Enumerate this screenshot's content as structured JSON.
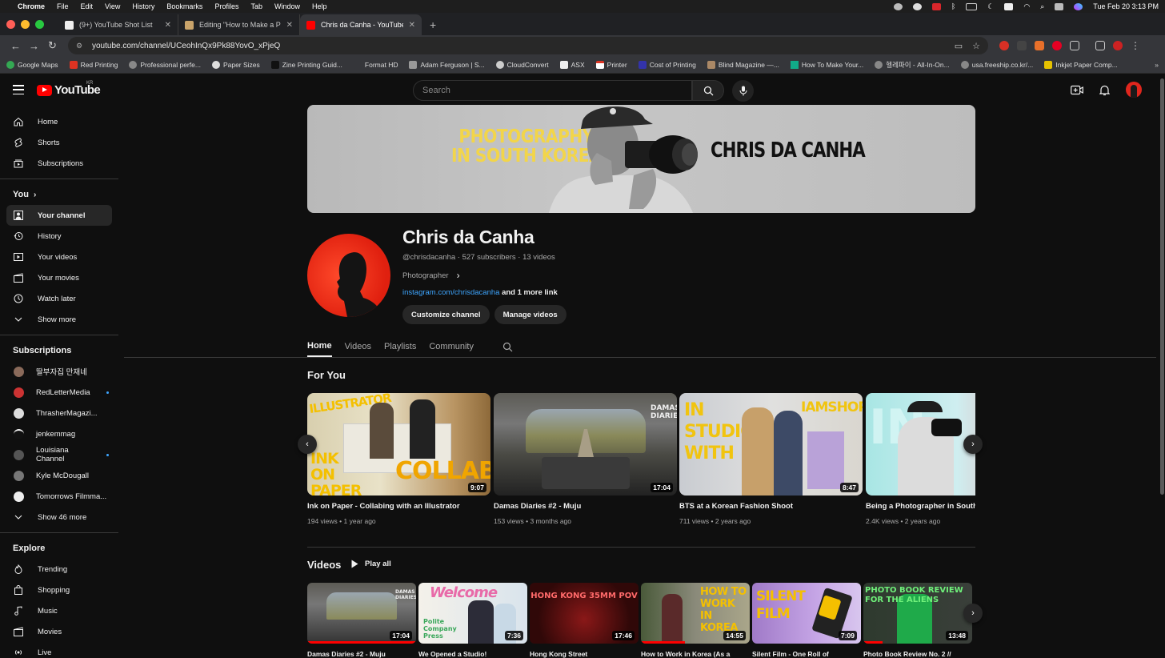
{
  "menubar": {
    "app": "Chrome",
    "items": [
      "File",
      "Edit",
      "View",
      "History",
      "Bookmarks",
      "Profiles",
      "Tab",
      "Window",
      "Help"
    ],
    "clock": "Tue Feb 20  3:13 PM"
  },
  "tabs": [
    {
      "title": "(9+) YouTube Shot List"
    },
    {
      "title": "Editing \"How to Make a Photo"
    },
    {
      "title": "Chris da Canha - YouTube"
    }
  ],
  "address": {
    "url": "youtube.com/channel/UCeohInQx9Pk88YovO_xPjeQ"
  },
  "bookmarks": [
    "Google Maps",
    "Red Printing",
    "Professional perfe...",
    "Paper Sizes",
    "Zine Printing Guid...",
    "Format HD",
    "Adam Ferguson | S...",
    "CloudConvert",
    "ASX",
    "Printer",
    "Cost of Printing",
    "Blind Magazine —...",
    "How To Make Your...",
    "헬레파이 - All-In-On...",
    "usa.freeship.co.kr/...",
    "Inkjet Paper Comp..."
  ],
  "header": {
    "logo": "YouTube",
    "region": "KR",
    "search_placeholder": "Search"
  },
  "sidebar": {
    "main": [
      {
        "label": "Home",
        "icon": "home-icon"
      },
      {
        "label": "Shorts",
        "icon": "shorts-icon"
      },
      {
        "label": "Subscriptions",
        "icon": "subscriptions-icon"
      }
    ],
    "you_heading": "You",
    "you": [
      {
        "label": "Your channel",
        "icon": "channel-icon"
      },
      {
        "label": "History",
        "icon": "history-icon"
      },
      {
        "label": "Your videos",
        "icon": "your-videos-icon"
      },
      {
        "label": "Your movies",
        "icon": "movies-icon"
      },
      {
        "label": "Watch later",
        "icon": "clock-icon"
      },
      {
        "label": "Show more",
        "icon": "chevron-down-icon"
      }
    ],
    "subs_heading": "Subscriptions",
    "subs": [
      {
        "label": "딸부자집 만재네",
        "color": "#8a6a5a",
        "dot": false
      },
      {
        "label": "RedLetterMedia",
        "color": "#c33",
        "dot": true
      },
      {
        "label": "ThrasherMagazi...",
        "color": "#ddd",
        "dot": true
      },
      {
        "label": "jenkemmag",
        "color": "#222",
        "dot": false
      },
      {
        "label": "Louisiana Channel",
        "color": "#333",
        "dot": true
      },
      {
        "label": "Kyle McDougall",
        "color": "#777",
        "dot": false
      },
      {
        "label": "Tomorrows Filmma...",
        "color": "#eee",
        "dot": false
      },
      {
        "label": "Show 46 more",
        "color": "",
        "dot": false
      }
    ],
    "explore_heading": "Explore",
    "explore": [
      {
        "label": "Trending",
        "icon": "trending-icon"
      },
      {
        "label": "Shopping",
        "icon": "shopping-icon"
      },
      {
        "label": "Music",
        "icon": "music-icon"
      },
      {
        "label": "Movies",
        "icon": "movies-icon"
      },
      {
        "label": "Live",
        "icon": "live-icon"
      }
    ]
  },
  "banner": {
    "tagline_1": "PHOTOGRAPHY",
    "tagline_2": "IN SOUTH KOREA",
    "name": "CHRIS DA CANHA"
  },
  "channel": {
    "name": "Chris da Canha",
    "meta": "@chrisdacanha · 527 subscribers · 13 videos",
    "description": "Photographer",
    "link": "instagram.com/chrisdacanha",
    "more_links": " and 1 more link",
    "customize": "Customize channel",
    "manage": "Manage videos"
  },
  "channel_tabs": [
    "Home",
    "Videos",
    "Playlists",
    "Community"
  ],
  "for_you": {
    "title": "For You",
    "videos": [
      {
        "title": "Ink on Paper - Collabing with an Illustrator",
        "meta": "194 views • 1 year ago",
        "duration": "9:07",
        "thumb_text_1": "ILLUSTRATOR",
        "thumb_text_2": "INK ON PAPER",
        "thumb_text_3": "COLLAB"
      },
      {
        "title": "Damas Diaries #2 - Muju",
        "meta": "153 views • 3 months ago",
        "duration": "17:04",
        "thumb_text_1": "DAMAS DIARIES"
      },
      {
        "title": "BTS at a Korean Fashion Shoot",
        "meta": "711 views • 2 years ago",
        "duration": "8:47",
        "thumb_text_1": "IN STUDIO WITH",
        "thumb_text_2": "IAMSHOP"
      },
      {
        "title": "Being a Photographer in South Ko",
        "meta": "2.4K views • 2 years ago",
        "duration": "",
        "thumb_text_1": "IN"
      }
    ]
  },
  "videos_section": {
    "title": "Videos",
    "play_all": "Play all",
    "videos": [
      {
        "title": "Damas Diaries #2 - Muju",
        "duration": "17:04",
        "thumb_text": "DAMAS DIARIES"
      },
      {
        "title": "We Opened a Studio!",
        "duration": "7:36",
        "thumb_text": "Polite Company Press"
      },
      {
        "title": "Hong Kong Street",
        "duration": "17:46",
        "thumb_text": "HONG KONG 35MM POV"
      },
      {
        "title": "How to Work in Korea (As a",
        "duration": "14:55",
        "thumb_text": "HOW TO WORK IN KOREA"
      },
      {
        "title": "Silent Film - One Roll of",
        "duration": "7:09",
        "thumb_text": "SILENT FILM"
      },
      {
        "title": "Photo Book Review No. 2 //",
        "duration": "13:48",
        "thumb_text": "PHOTO BOOK REVIEW FOR THE ALIENS"
      }
    ]
  }
}
